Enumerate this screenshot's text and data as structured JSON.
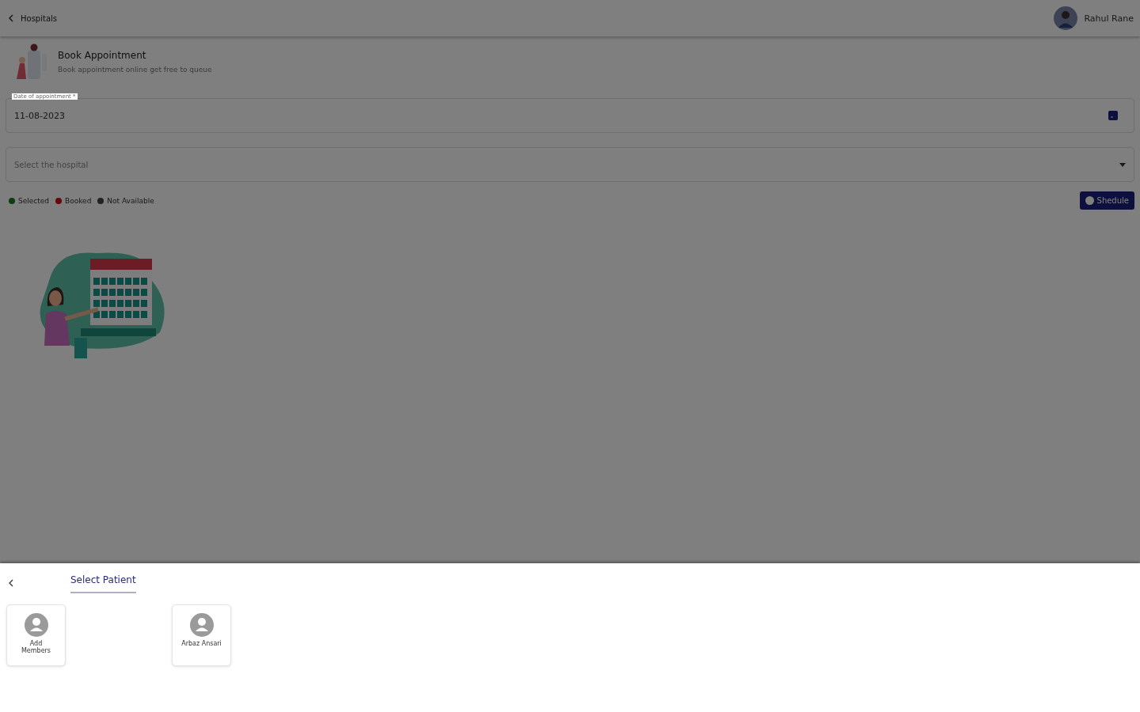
{
  "top_bar": {
    "back_label": "Hospitals",
    "user_name": "Rahul Rane"
  },
  "header": {
    "title": "Book Appointment",
    "subtitle": "Book appointment online get free to queue"
  },
  "date_field": {
    "label": "Date of appointment *",
    "value": "11-08-2023"
  },
  "hospital_select": {
    "placeholder": "Select the hospital"
  },
  "legend": [
    {
      "label": "Selected",
      "color": "#0f3d0f"
    },
    {
      "label": "Booked",
      "color": "#680808"
    },
    {
      "label": "Not Available",
      "color": "#222222"
    }
  ],
  "schedule_button": {
    "label": "Shedule"
  },
  "sheet": {
    "tabs": [
      {
        "label": "Select Patient",
        "selected": true
      }
    ],
    "patients": [
      {
        "kind": "add",
        "name": "Add Members"
      },
      {
        "kind": "member",
        "name": "Arbaz Ansari"
      }
    ]
  }
}
